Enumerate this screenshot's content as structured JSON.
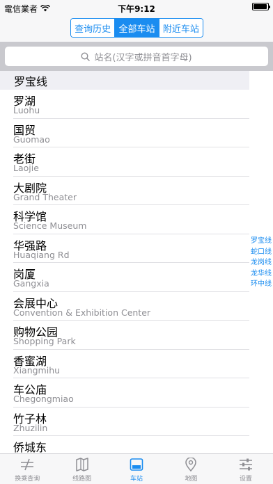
{
  "status_bar": {
    "carrier": "電信業者",
    "time": "下午9:12",
    "battery_level": 0.95
  },
  "segments": [
    {
      "label": "查询历史",
      "active": false
    },
    {
      "label": "全部车站",
      "active": true
    },
    {
      "label": "附近车站",
      "active": false
    }
  ],
  "search": {
    "placeholder": "站名(汉字或拼音首字母)"
  },
  "list": {
    "section_title": "罗宝线",
    "stations": [
      {
        "name": "罗湖",
        "pinyin": "Luohu"
      },
      {
        "name": "国贸",
        "pinyin": "Guomao"
      },
      {
        "name": "老街",
        "pinyin": "Laojie"
      },
      {
        "name": "大剧院",
        "pinyin": "Grand Theater"
      },
      {
        "name": "科学馆",
        "pinyin": "Science Museum"
      },
      {
        "name": "华强路",
        "pinyin": "Huaqiang Rd"
      },
      {
        "name": "岗厦",
        "pinyin": "Gangxia"
      },
      {
        "name": "会展中心",
        "pinyin": "Convention & Exhibition Center"
      },
      {
        "name": "购物公园",
        "pinyin": "Shopping Park"
      },
      {
        "name": "香蜜湖",
        "pinyin": "Xiangmihu"
      },
      {
        "name": "车公庙",
        "pinyin": "Chegongmiao"
      },
      {
        "name": "竹子林",
        "pinyin": "Zhuzilin"
      },
      {
        "name": "侨城东",
        "pinyin": ""
      }
    ]
  },
  "index": [
    "罗宝线",
    "蛇口线",
    "龙岗线",
    "龙华线",
    "环中线"
  ],
  "tabs": [
    {
      "label": "换乘查询",
      "icon": "transfer-icon",
      "active": false
    },
    {
      "label": "线路图",
      "icon": "map-book-icon",
      "active": false
    },
    {
      "label": "车站",
      "icon": "station-icon",
      "active": true
    },
    {
      "label": "地图",
      "icon": "location-pin-icon",
      "active": false
    },
    {
      "label": "设置",
      "icon": "settings-sliders-icon",
      "active": false
    }
  ],
  "colors": {
    "accent": "#1a8cf0",
    "secondary_text": "#8e8e93"
  }
}
